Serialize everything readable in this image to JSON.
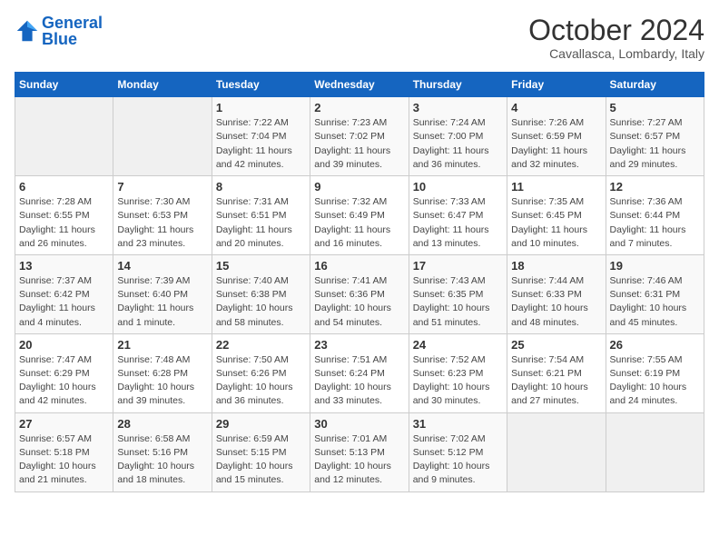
{
  "logo": {
    "text_general": "General",
    "text_blue": "Blue"
  },
  "header": {
    "title": "October 2024",
    "location": "Cavallasca, Lombardy, Italy"
  },
  "days_of_week": [
    "Sunday",
    "Monday",
    "Tuesday",
    "Wednesday",
    "Thursday",
    "Friday",
    "Saturday"
  ],
  "weeks": [
    [
      {
        "day": "",
        "sunrise": "",
        "sunset": "",
        "daylight": ""
      },
      {
        "day": "",
        "sunrise": "",
        "sunset": "",
        "daylight": ""
      },
      {
        "day": "1",
        "sunrise": "Sunrise: 7:22 AM",
        "sunset": "Sunset: 7:04 PM",
        "daylight": "Daylight: 11 hours and 42 minutes."
      },
      {
        "day": "2",
        "sunrise": "Sunrise: 7:23 AM",
        "sunset": "Sunset: 7:02 PM",
        "daylight": "Daylight: 11 hours and 39 minutes."
      },
      {
        "day": "3",
        "sunrise": "Sunrise: 7:24 AM",
        "sunset": "Sunset: 7:00 PM",
        "daylight": "Daylight: 11 hours and 36 minutes."
      },
      {
        "day": "4",
        "sunrise": "Sunrise: 7:26 AM",
        "sunset": "Sunset: 6:59 PM",
        "daylight": "Daylight: 11 hours and 32 minutes."
      },
      {
        "day": "5",
        "sunrise": "Sunrise: 7:27 AM",
        "sunset": "Sunset: 6:57 PM",
        "daylight": "Daylight: 11 hours and 29 minutes."
      }
    ],
    [
      {
        "day": "6",
        "sunrise": "Sunrise: 7:28 AM",
        "sunset": "Sunset: 6:55 PM",
        "daylight": "Daylight: 11 hours and 26 minutes."
      },
      {
        "day": "7",
        "sunrise": "Sunrise: 7:30 AM",
        "sunset": "Sunset: 6:53 PM",
        "daylight": "Daylight: 11 hours and 23 minutes."
      },
      {
        "day": "8",
        "sunrise": "Sunrise: 7:31 AM",
        "sunset": "Sunset: 6:51 PM",
        "daylight": "Daylight: 11 hours and 20 minutes."
      },
      {
        "day": "9",
        "sunrise": "Sunrise: 7:32 AM",
        "sunset": "Sunset: 6:49 PM",
        "daylight": "Daylight: 11 hours and 16 minutes."
      },
      {
        "day": "10",
        "sunrise": "Sunrise: 7:33 AM",
        "sunset": "Sunset: 6:47 PM",
        "daylight": "Daylight: 11 hours and 13 minutes."
      },
      {
        "day": "11",
        "sunrise": "Sunrise: 7:35 AM",
        "sunset": "Sunset: 6:45 PM",
        "daylight": "Daylight: 11 hours and 10 minutes."
      },
      {
        "day": "12",
        "sunrise": "Sunrise: 7:36 AM",
        "sunset": "Sunset: 6:44 PM",
        "daylight": "Daylight: 11 hours and 7 minutes."
      }
    ],
    [
      {
        "day": "13",
        "sunrise": "Sunrise: 7:37 AM",
        "sunset": "Sunset: 6:42 PM",
        "daylight": "Daylight: 11 hours and 4 minutes."
      },
      {
        "day": "14",
        "sunrise": "Sunrise: 7:39 AM",
        "sunset": "Sunset: 6:40 PM",
        "daylight": "Daylight: 11 hours and 1 minute."
      },
      {
        "day": "15",
        "sunrise": "Sunrise: 7:40 AM",
        "sunset": "Sunset: 6:38 PM",
        "daylight": "Daylight: 10 hours and 58 minutes."
      },
      {
        "day": "16",
        "sunrise": "Sunrise: 7:41 AM",
        "sunset": "Sunset: 6:36 PM",
        "daylight": "Daylight: 10 hours and 54 minutes."
      },
      {
        "day": "17",
        "sunrise": "Sunrise: 7:43 AM",
        "sunset": "Sunset: 6:35 PM",
        "daylight": "Daylight: 10 hours and 51 minutes."
      },
      {
        "day": "18",
        "sunrise": "Sunrise: 7:44 AM",
        "sunset": "Sunset: 6:33 PM",
        "daylight": "Daylight: 10 hours and 48 minutes."
      },
      {
        "day": "19",
        "sunrise": "Sunrise: 7:46 AM",
        "sunset": "Sunset: 6:31 PM",
        "daylight": "Daylight: 10 hours and 45 minutes."
      }
    ],
    [
      {
        "day": "20",
        "sunrise": "Sunrise: 7:47 AM",
        "sunset": "Sunset: 6:29 PM",
        "daylight": "Daylight: 10 hours and 42 minutes."
      },
      {
        "day": "21",
        "sunrise": "Sunrise: 7:48 AM",
        "sunset": "Sunset: 6:28 PM",
        "daylight": "Daylight: 10 hours and 39 minutes."
      },
      {
        "day": "22",
        "sunrise": "Sunrise: 7:50 AM",
        "sunset": "Sunset: 6:26 PM",
        "daylight": "Daylight: 10 hours and 36 minutes."
      },
      {
        "day": "23",
        "sunrise": "Sunrise: 7:51 AM",
        "sunset": "Sunset: 6:24 PM",
        "daylight": "Daylight: 10 hours and 33 minutes."
      },
      {
        "day": "24",
        "sunrise": "Sunrise: 7:52 AM",
        "sunset": "Sunset: 6:23 PM",
        "daylight": "Daylight: 10 hours and 30 minutes."
      },
      {
        "day": "25",
        "sunrise": "Sunrise: 7:54 AM",
        "sunset": "Sunset: 6:21 PM",
        "daylight": "Daylight: 10 hours and 27 minutes."
      },
      {
        "day": "26",
        "sunrise": "Sunrise: 7:55 AM",
        "sunset": "Sunset: 6:19 PM",
        "daylight": "Daylight: 10 hours and 24 minutes."
      }
    ],
    [
      {
        "day": "27",
        "sunrise": "Sunrise: 6:57 AM",
        "sunset": "Sunset: 5:18 PM",
        "daylight": "Daylight: 10 hours and 21 minutes."
      },
      {
        "day": "28",
        "sunrise": "Sunrise: 6:58 AM",
        "sunset": "Sunset: 5:16 PM",
        "daylight": "Daylight: 10 hours and 18 minutes."
      },
      {
        "day": "29",
        "sunrise": "Sunrise: 6:59 AM",
        "sunset": "Sunset: 5:15 PM",
        "daylight": "Daylight: 10 hours and 15 minutes."
      },
      {
        "day": "30",
        "sunrise": "Sunrise: 7:01 AM",
        "sunset": "Sunset: 5:13 PM",
        "daylight": "Daylight: 10 hours and 12 minutes."
      },
      {
        "day": "31",
        "sunrise": "Sunrise: 7:02 AM",
        "sunset": "Sunset: 5:12 PM",
        "daylight": "Daylight: 10 hours and 9 minutes."
      },
      {
        "day": "",
        "sunrise": "",
        "sunset": "",
        "daylight": ""
      },
      {
        "day": "",
        "sunrise": "",
        "sunset": "",
        "daylight": ""
      }
    ]
  ]
}
